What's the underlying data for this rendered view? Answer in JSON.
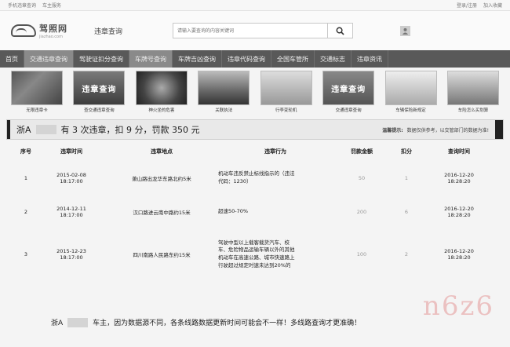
{
  "topbar": {
    "left": [
      "手机违章查询",
      "车主服务"
    ],
    "right": [
      "登录/注册",
      "加入收藏"
    ]
  },
  "logo": {
    "name": "驾照网",
    "domain": "jiazhao.com"
  },
  "channel_title": "违章查询",
  "search": {
    "placeholder": "请输入要查询的内容关键词"
  },
  "nav": {
    "items": [
      {
        "label": "首页",
        "active": false
      },
      {
        "label": "交通违章查询",
        "active": true
      },
      {
        "label": "驾驶证扣分查询",
        "active": false
      },
      {
        "label": "车牌号查询",
        "active": true
      },
      {
        "label": "车牌吉凶查询",
        "active": false
      },
      {
        "label": "违章代码查询",
        "active": false
      },
      {
        "label": "全国车管所",
        "active": false
      },
      {
        "label": "交通标志",
        "active": false
      },
      {
        "label": "违章资讯",
        "active": false
      }
    ]
  },
  "thumbs": [
    {
      "caption": "无限违章卡",
      "overlay": ""
    },
    {
      "caption": "查交通违章查询",
      "overlay": "违章查询"
    },
    {
      "caption": "神火坐的危害",
      "overlay": ""
    },
    {
      "caption": "关联执法",
      "overlay": ""
    },
    {
      "caption": "行李变轮机",
      "overlay": ""
    },
    {
      "caption": "交通违章查询",
      "overlay": "违章查询"
    },
    {
      "caption": "车辆保险新规定",
      "overlay": ""
    },
    {
      "caption": "车险怎么买划算",
      "overlay": ""
    }
  ],
  "summary": {
    "prefix": "浙A",
    "text": "有 3 次违章，扣 9 分，罚款 350 元",
    "tip_label": "温馨提示:",
    "tip_text": "数据仅供参考，以交管部门的数据为准!"
  },
  "table": {
    "headers": [
      "序号",
      "违章时间",
      "违章地点",
      "违章行为",
      "罚款金额",
      "扣分",
      "查询时间"
    ],
    "rows": [
      {
        "no": "1",
        "time": [
          "2015-02-08",
          "18:17:00"
        ],
        "place": "萧山路出龙华东路北约5米",
        "act": [
          "机动车违反禁止标线指示的（违法",
          "代码：1230）"
        ],
        "fine": "50",
        "points": "1",
        "query": [
          "2016-12-20",
          "18:28:20"
        ]
      },
      {
        "no": "2",
        "time": [
          "2014-12-11",
          "18:17:00"
        ],
        "place": "汉口路进云南中路约15米",
        "act": [
          "超速50-70%"
        ],
        "fine": "200",
        "points": "6",
        "query": [
          "2016-12-20",
          "18:28:20"
        ]
      },
      {
        "no": "3",
        "time": [
          "2015-12-23",
          "18:17:00"
        ],
        "place": "四川南路人民路东约15米",
        "act": [
          "驾驶中型以上载客载货汽车、校",
          "车、危险物品运输车辆以外的其他",
          "机动车在高速公路、城市快速路上",
          "行驶超过规定时速未达到20%的"
        ],
        "fine": "100",
        "points": "2",
        "query": [
          "2016-12-20",
          "18:28:20"
        ]
      }
    ]
  },
  "notice": {
    "prefix": "浙A",
    "text": "车主，因为数据源不同，各条线路数据更新时间可能会不一样！多线路查询才更准确！"
  },
  "watermark": "n6z6"
}
